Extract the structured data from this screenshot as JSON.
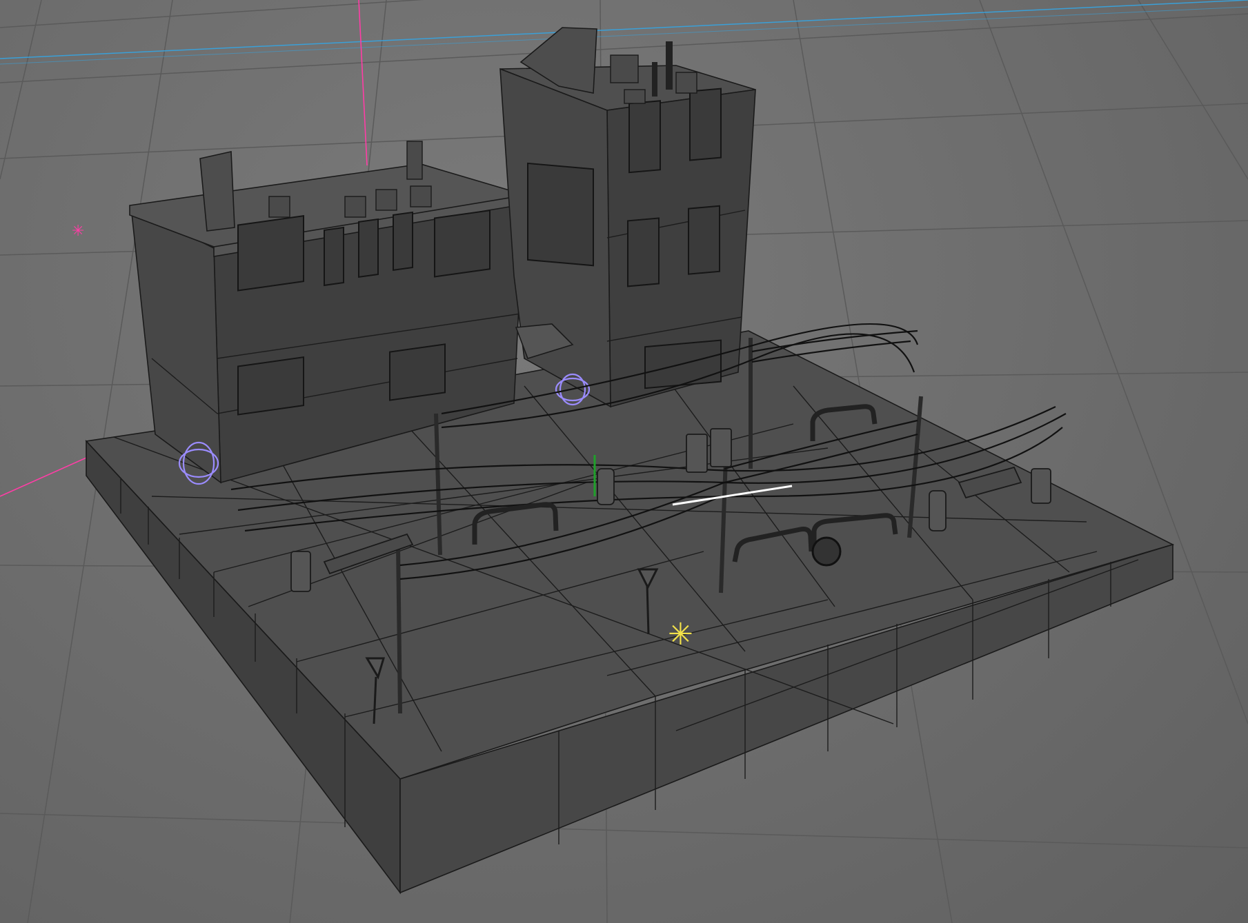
{
  "viewport": {
    "background": "#6e6e6e",
    "grid_color": "#585858",
    "axis_x_color": "#ff3da6",
    "axis_z_color": "#3aa0d8",
    "selection_color": "#9b8cff",
    "light_marker_color": "#f2e14a",
    "light_marker_label": "✳",
    "point_marker_label": "✳",
    "mode": "wireframe-shaded"
  },
  "scene": {
    "objects": [
      {
        "name": "building-left",
        "type": "building",
        "floors": 3
      },
      {
        "name": "building-right",
        "type": "building",
        "floors": 4
      },
      {
        "name": "sidewalk-base",
        "type": "ground-tiles"
      },
      {
        "name": "utility-poles",
        "type": "pole",
        "count": 5
      },
      {
        "name": "power-lines",
        "type": "wires"
      },
      {
        "name": "benches",
        "type": "bench",
        "count": 2
      },
      {
        "name": "fire-hydrants",
        "type": "hydrant",
        "count": 2
      },
      {
        "name": "trash-cans",
        "type": "trash-can",
        "count": 3
      },
      {
        "name": "bike-racks",
        "type": "rack",
        "count": 4
      },
      {
        "name": "yield-signs",
        "type": "sign",
        "count": 2
      },
      {
        "name": "manhole-cover",
        "type": "cover"
      },
      {
        "name": "awning",
        "type": "awning"
      },
      {
        "name": "newspaper-boxes",
        "type": "box",
        "count": 2
      }
    ]
  }
}
